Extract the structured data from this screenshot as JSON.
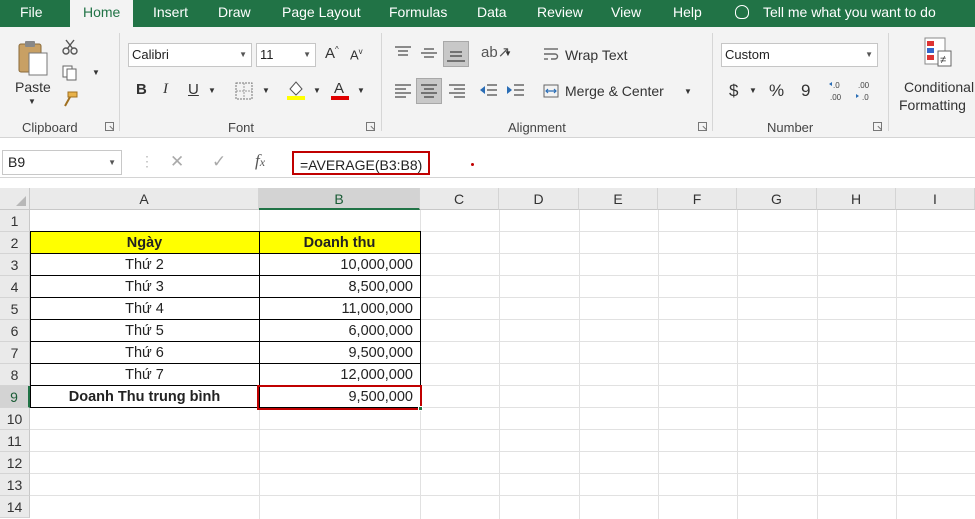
{
  "tabs": [
    {
      "label": "File",
      "active": false
    },
    {
      "label": "Home",
      "active": true
    },
    {
      "label": "Insert",
      "active": false
    },
    {
      "label": "Draw",
      "active": false
    },
    {
      "label": "Page Layout",
      "active": false
    },
    {
      "label": "Formulas",
      "active": false
    },
    {
      "label": "Data",
      "active": false
    },
    {
      "label": "Review",
      "active": false
    },
    {
      "label": "View",
      "active": false
    },
    {
      "label": "Help",
      "active": false
    }
  ],
  "tell_me": "Tell me what you want to do",
  "ribbon": {
    "clipboard": {
      "paste_label": "Paste",
      "group_label": "Clipboard"
    },
    "font": {
      "font_name": "Calibri",
      "font_size": "11",
      "bold": "B",
      "italic": "I",
      "underline": "U",
      "group_label": "Font"
    },
    "alignment": {
      "wrap_text": "Wrap Text",
      "merge_center": "Merge & Center",
      "group_label": "Alignment"
    },
    "number": {
      "format": "Custom",
      "currency": "$",
      "percent": "%",
      "comma": "9",
      "group_label": "Number"
    },
    "styles": {
      "conditional_formatting_line1": "Conditional",
      "conditional_formatting_line2": "Formatting"
    }
  },
  "formula_bar": {
    "name_box": "B9",
    "formula": "=AVERAGE(B3:B8)"
  },
  "columns": [
    "A",
    "B",
    "C",
    "D",
    "E",
    "F",
    "G",
    "H",
    "I"
  ],
  "rows": [
    "1",
    "2",
    "3",
    "4",
    "5",
    "6",
    "7",
    "8",
    "9",
    "10",
    "11",
    "12",
    "13",
    "14"
  ],
  "sheet": {
    "header": {
      "a": "Ngày",
      "b": "Doanh thu"
    },
    "data_rows": [
      {
        "a": "Thứ 2",
        "b": "10,000,000"
      },
      {
        "a": "Thứ 3",
        "b": "8,500,000"
      },
      {
        "a": "Thứ 4",
        "b": "11,000,000"
      },
      {
        "a": "Thứ 5",
        "b": "6,000,000"
      },
      {
        "a": "Thứ 6",
        "b": "9,500,000"
      },
      {
        "a": "Thứ 7",
        "b": "12,000,000"
      }
    ],
    "summary": {
      "a": "Doanh Thu trung bình",
      "b": "9,500,000"
    }
  },
  "colors": {
    "ribbon_accent": "#217346",
    "highlight_border": "#c00000",
    "header_fill": "#ffff00"
  }
}
